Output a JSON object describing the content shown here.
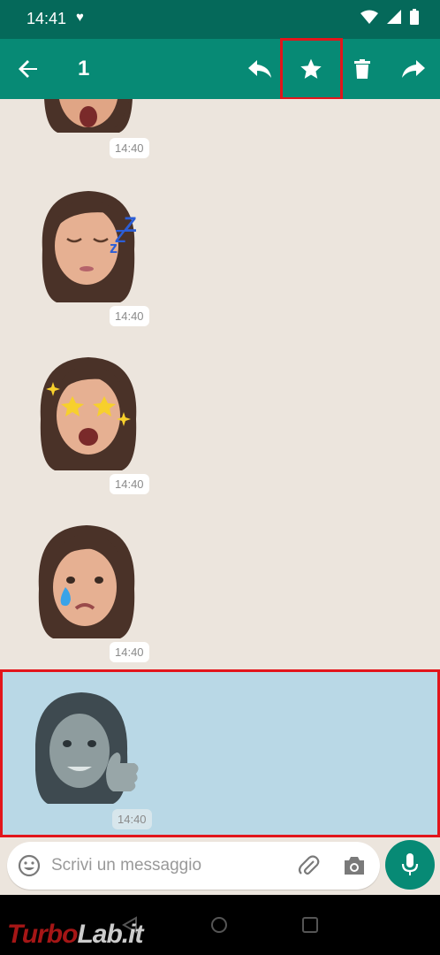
{
  "status": {
    "time": "14:41"
  },
  "action_bar": {
    "selected_count": "1"
  },
  "messages": [
    {
      "time": "14:40",
      "sticker": "memoji-yawn"
    },
    {
      "time": "14:40",
      "sticker": "memoji-sleeping"
    },
    {
      "time": "14:40",
      "sticker": "memoji-star-struck"
    },
    {
      "time": "14:40",
      "sticker": "memoji-crying"
    },
    {
      "time": "14:40",
      "sticker": "memoji-thumbs-up"
    }
  ],
  "composer": {
    "placeholder": "Scrivi un messaggio"
  },
  "watermark": {
    "part1": "Turbo",
    "part2": "Lab.it"
  },
  "colors": {
    "accent": "#078a75",
    "status": "#05695a",
    "selection": "#b9d8e6",
    "highlight": "#e2151b"
  }
}
